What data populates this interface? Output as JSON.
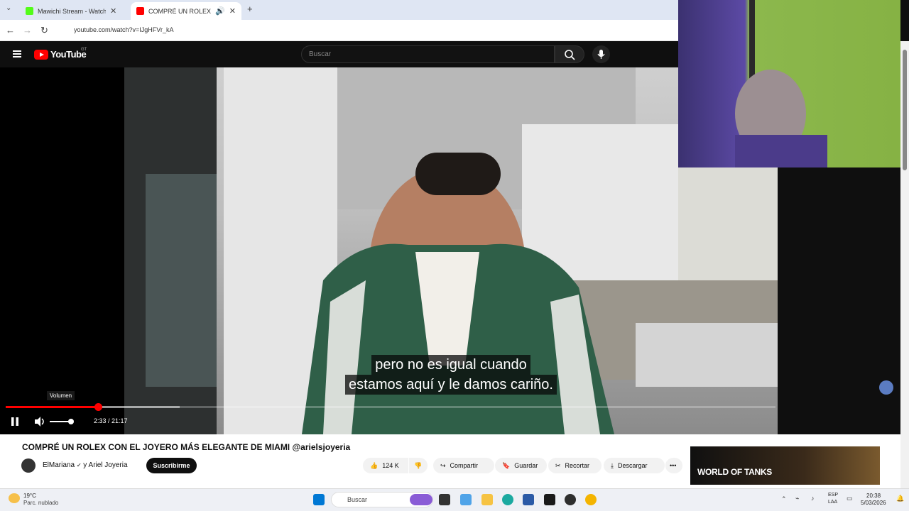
{
  "browser": {
    "tabs": [
      {
        "title": "Mawichi Stream - Watch L",
        "favicon_color": "#53fc18"
      },
      {
        "title": "COMPRÉ UN ROLEX CON E",
        "favicon_color": "#ff0000"
      }
    ],
    "url": "youtube.com/watch?v=IJgHFVr_kA",
    "new_tab_symbol": "+"
  },
  "youtube": {
    "logo_text": "YouTube",
    "country_code": "GT",
    "search_placeholder": "Buscar"
  },
  "player": {
    "subtitle_lines": [
      "pero no es igual cuando",
      "estamos aquí y le damos cariño."
    ],
    "tooltip": "Volumen",
    "time_display": "2:33 / 21:17",
    "progress_fraction": 0.12,
    "buffer_fraction": 0.226,
    "volume_fraction": 1.0,
    "accent_color": "#ff0000"
  },
  "video_info": {
    "title": "COMPRÉ UN ROLEX CON EL JOYERO MÁS ELEGANTE DE MIAMI @arielsjoyeria",
    "channel": "ElMariana",
    "collab": "y Ariel Joyeria",
    "subscribe_label": "Suscribirme",
    "like_count": "124 K",
    "actions": [
      "Compartir",
      "Guardar",
      "Recortar",
      "Descargar"
    ]
  },
  "ad": {
    "text": "WORLD OF TANKS"
  },
  "taskbar": {
    "weather_temp": "19°C",
    "weather_desc": "Parc. nublado",
    "search_label": "Buscar",
    "lang_top": "ESP",
    "lang_bottom": "LAA",
    "time": "20:38",
    "date": "5/03/2026"
  }
}
